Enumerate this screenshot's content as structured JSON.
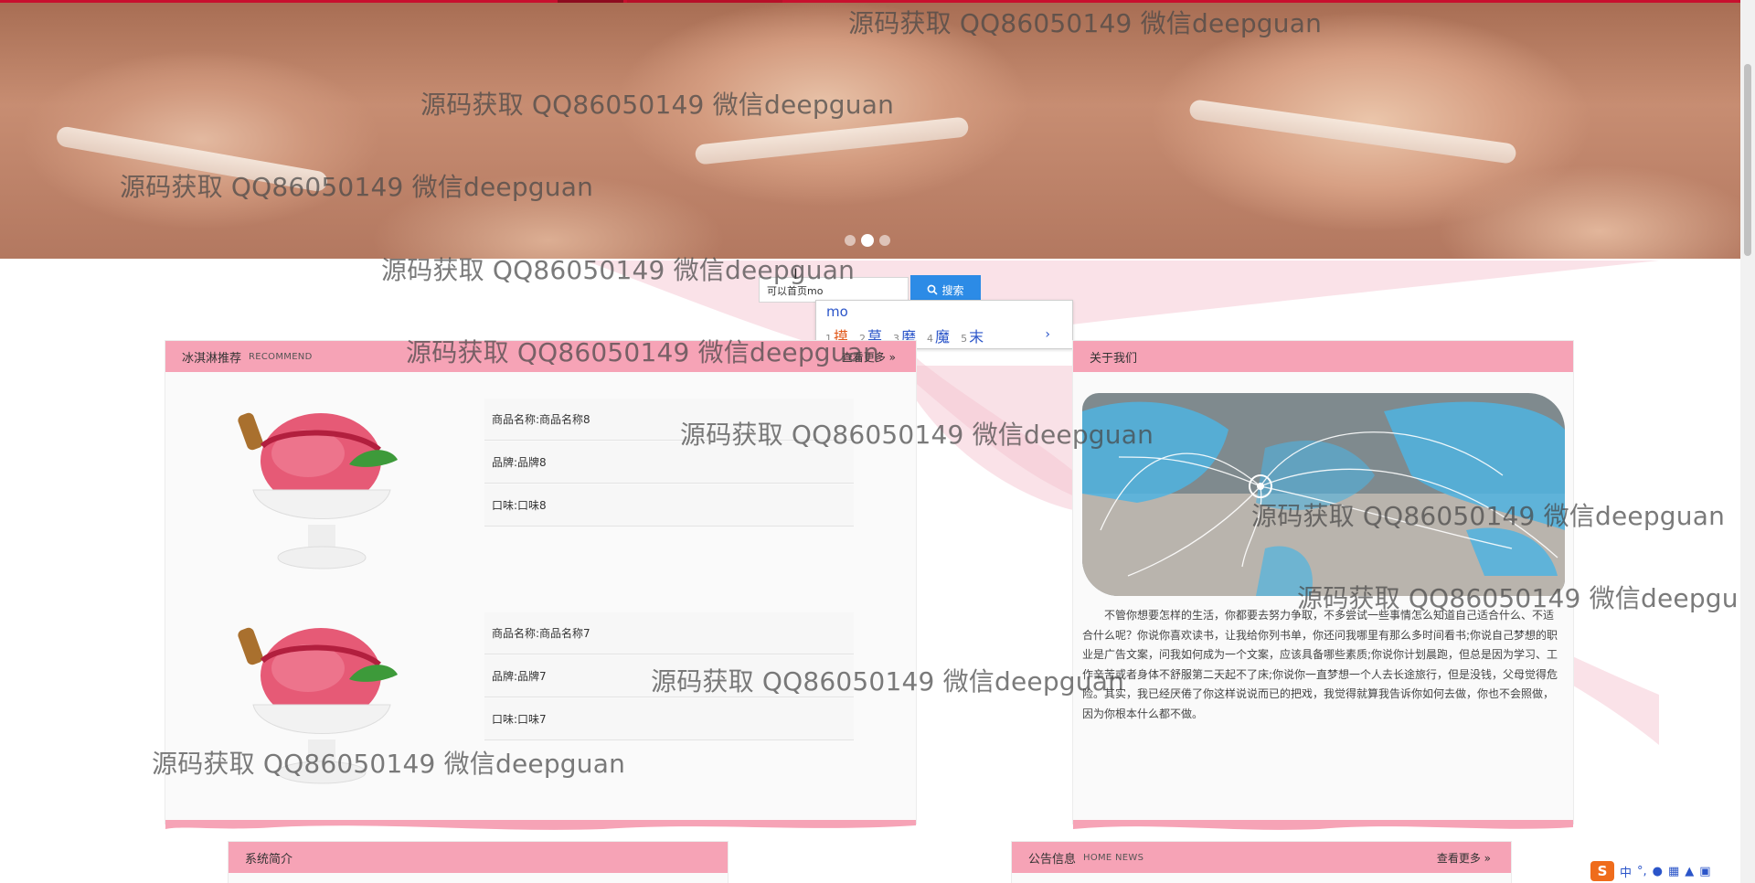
{
  "banner": {
    "slides": 3,
    "active_slide": 2
  },
  "search": {
    "input_value": "可以首页mo",
    "button_label": "搜索",
    "ime": {
      "typed": "mo",
      "candidates": [
        {
          "num": "1",
          "char": "摸"
        },
        {
          "num": "2",
          "char": "莫"
        },
        {
          "num": "3",
          "char": "磨"
        },
        {
          "num": "4",
          "char": "魔"
        },
        {
          "num": "5",
          "char": "末"
        }
      ],
      "next": "›"
    }
  },
  "recommend": {
    "title": "冰淇淋推荐",
    "subtitle": "RECOMMEND",
    "more": "查看更多",
    "items": [
      {
        "name": "商品名称:商品名称8",
        "brand": "品牌:品牌8",
        "flavor": "口味:口味8"
      },
      {
        "name": "商品名称:商品名称7",
        "brand": "品牌:品牌7",
        "flavor": "口味:口味7"
      }
    ]
  },
  "about": {
    "title": "关于我们",
    "text": "不管你想要怎样的生活，你都要去努力争取，不多尝试一些事情怎么知道自己适合什么、不适合什么呢？你说你喜欢读书，让我给你列书单，你还问我哪里有那么多时间看书;你说自己梦想的职业是广告文案，问我如何成为一个文案，应该具备哪些素质;你说你计划晨跑，但总是因为学习、工作辛苦或者身体不舒服第二天起不了床;你说你一直梦想一个人去长途旅行，但是没钱，父母觉得危险。其实，我已经厌倦了你这样说说而已的把戏，我觉得就算我告诉你如何去做，你也不会照做，因为你根本什么都不做。"
  },
  "intro": {
    "title": "系统简介"
  },
  "notice": {
    "title": "公告信息",
    "subtitle": "HOME NEWS",
    "more": "查看更多"
  },
  "watermarks": [
    "源码获取 QQ86050149 微信deepguan",
    "源码获取 QQ86050149 微信deepguan",
    "源码获取 QQ86050149 微信deepguan",
    "源码获取 QQ86050149 微信deepguan",
    "源码获取 QQ86050149 微信deepguan",
    "源码获取 QQ86050149 微信deepguan",
    "源码获取 QQ86050149 微信deepguan",
    "源码获取 QQ86050149 微信deepguan",
    "源码获取 QQ86050149 微信deepguan",
    "源码获取 QQ86050149 微信deepgu"
  ],
  "taskbar_ime": {
    "logo": "S",
    "mode": "中"
  },
  "colors": {
    "pink": "#f6a3b6",
    "search_blue": "#2c8be6",
    "ime_orange": "#e25a1c"
  }
}
